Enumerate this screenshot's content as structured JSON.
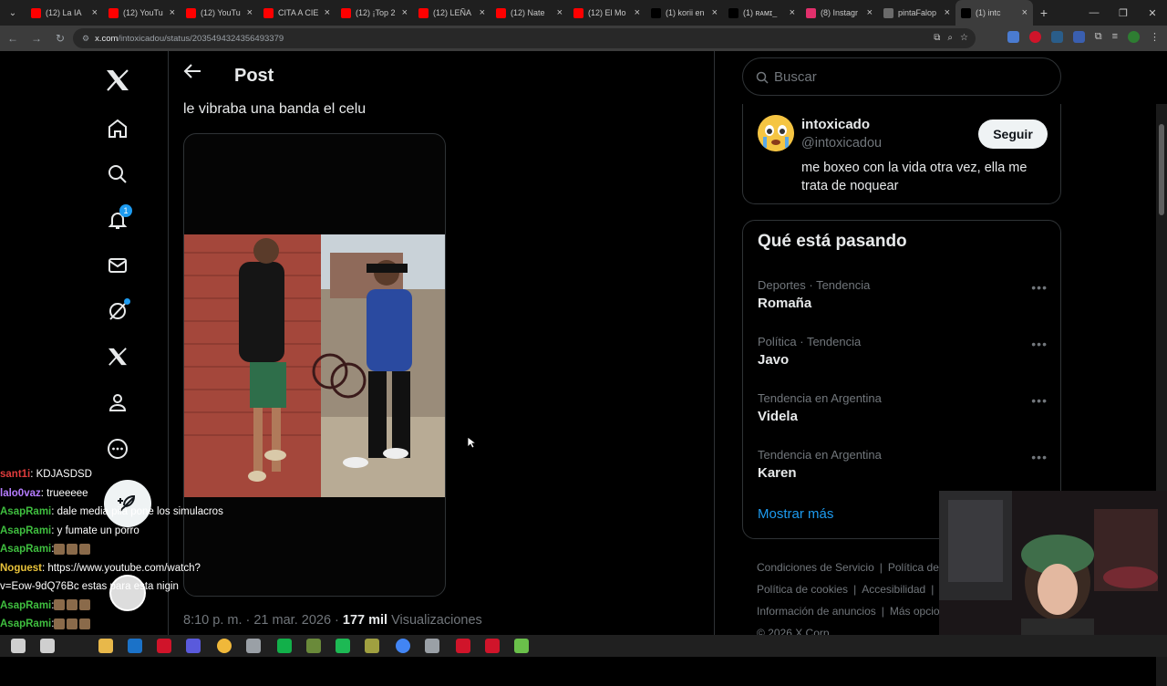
{
  "browser": {
    "tabs": [
      {
        "label": "(12) La IA",
        "color": "#ff0000"
      },
      {
        "label": "(12) YouTu",
        "color": "#ff0000"
      },
      {
        "label": "(12) YouTu",
        "color": "#ff0000"
      },
      {
        "label": "CITA A CIE",
        "color": "#ff0000"
      },
      {
        "label": "(12) ¡Top 2",
        "color": "#ff0000"
      },
      {
        "label": "(12) LEÑA",
        "color": "#ff0000"
      },
      {
        "label": "(12) Nate",
        "color": "#ff0000"
      },
      {
        "label": "(12) El Mo",
        "color": "#ff0000"
      },
      {
        "label": "(1) korii en",
        "color": "#000000"
      },
      {
        "label": "(1) ʀᴀᴍɪ_",
        "color": "#000000"
      },
      {
        "label": "(8) Instagr",
        "color": "#e1306c"
      },
      {
        "label": "pintaFalop",
        "color": "#6b6b6b"
      },
      {
        "label": "(1) intc",
        "color": "#000000"
      }
    ],
    "url_domain": "x.com",
    "url_path": "/intoxicadou/status/2035494324356493379"
  },
  "nav": {
    "notification_count": "1"
  },
  "post": {
    "header_title": "Post",
    "text": "le vibraba una banda el celu",
    "time": "8:10 p. m. · 21 mar. 2026 ·",
    "views_count": "177 mil",
    "views_label": "Visualizaciones"
  },
  "sidebar": {
    "search_placeholder": "Buscar",
    "profile": {
      "name": "intoxicado",
      "handle": "@intoxicadou",
      "follow_label": "Seguir",
      "bio": "me boxeo con la vida otra vez, ella me trata de noquear"
    },
    "trends_title": "Qué está pasando",
    "trends": [
      {
        "category": "Deportes · Tendencia",
        "name": "Romaña"
      },
      {
        "category": "Política · Tendencia",
        "name": "Javo"
      },
      {
        "category": "Tendencia en Argentina",
        "name": "Videla"
      },
      {
        "category": "Tendencia en Argentina",
        "name": "Karen"
      }
    ],
    "show_more": "Mostrar más",
    "footer": {
      "terms": "Condiciones de Servicio",
      "privacy": "Política de",
      "cookies": "Política de cookies",
      "accessibility": "Accesibilidad",
      "ads": "Información de anuncios",
      "more": "Más opcio",
      "copyright": "© 2026 X Corp."
    }
  },
  "chat": [
    {
      "user": "sant1i",
      "user_color": "#e03c3c",
      "text": ": KDJASDSD"
    },
    {
      "user": "lalo0vaz",
      "user_color": "#b57cff",
      "text": ": trueeeee"
    },
    {
      "user": "AsapRami",
      "user_color": "#3fbf3f",
      "text": ": dale media pila pone los simulacros"
    },
    {
      "user": "AsapRami",
      "user_color": "#3fbf3f",
      "text": ": y fumate un porro"
    },
    {
      "user": "AsapRami",
      "user_color": "#3fbf3f",
      "text": ":"
    },
    {
      "user": "Noguest",
      "user_color": "#e8c23a",
      "text": ": https://www.youtube.com/watch?v=Eow-9dQ76Bc estas para esta nigin"
    },
    {
      "user": "AsapRami",
      "user_color": "#3fbf3f",
      "text": ":"
    },
    {
      "user": "AsapRami",
      "user_color": "#3fbf3f",
      "text": ":"
    }
  ]
}
